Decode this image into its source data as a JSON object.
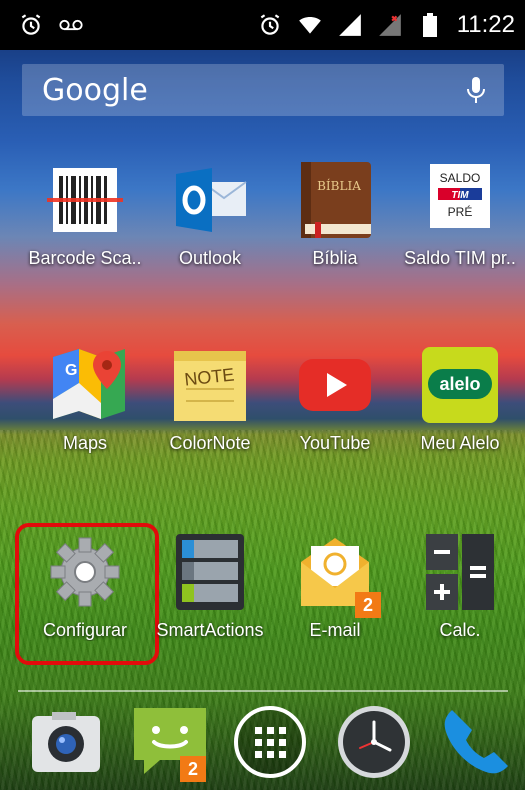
{
  "status_bar": {
    "time": "11:22",
    "left_icons": [
      "alarm-icon",
      "voicemail-icon"
    ],
    "right_icons": [
      "alarm-icon",
      "wifi-icon",
      "signal-icon",
      "signal-no-sim-icon",
      "battery-icon"
    ]
  },
  "search": {
    "logo": "Google",
    "mic_icon": "microphone-icon"
  },
  "apps": [
    {
      "label": "Barcode Sca..",
      "icon": "barcode-scanner-icon"
    },
    {
      "label": "Outlook",
      "icon": "outlook-icon"
    },
    {
      "label": "Bíblia",
      "icon": "bible-icon",
      "icon_text": "BÍBLIA"
    },
    {
      "label": "Saldo TIM pr..",
      "icon": "saldo-tim-icon",
      "icon_text_top": "SALDO",
      "icon_text_mid": "TIM",
      "icon_text_bottom": "PRÉ"
    },
    {
      "label": "Maps",
      "icon": "maps-icon"
    },
    {
      "label": "ColorNote",
      "icon": "colornote-icon",
      "icon_text": "NOTE"
    },
    {
      "label": "YouTube",
      "icon": "youtube-icon"
    },
    {
      "label": "Meu Alelo",
      "icon": "alelo-icon",
      "icon_text": "alelo"
    },
    {
      "label": "Configurar",
      "icon": "settings-gear-icon",
      "highlighted": true
    },
    {
      "label": "SmartActions",
      "icon": "smartactions-icon"
    },
    {
      "label": "E-mail",
      "icon": "email-icon",
      "badge": "2"
    },
    {
      "label": "Calc.",
      "icon": "calculator-icon"
    }
  ],
  "dock": [
    {
      "icon": "camera-icon"
    },
    {
      "icon": "messaging-icon",
      "badge": "2"
    },
    {
      "icon": "app-drawer-icon"
    },
    {
      "icon": "clock-icon"
    },
    {
      "icon": "phone-icon"
    }
  ],
  "colors": {
    "highlight": "#e20b0b",
    "badge": "#f27a15"
  }
}
